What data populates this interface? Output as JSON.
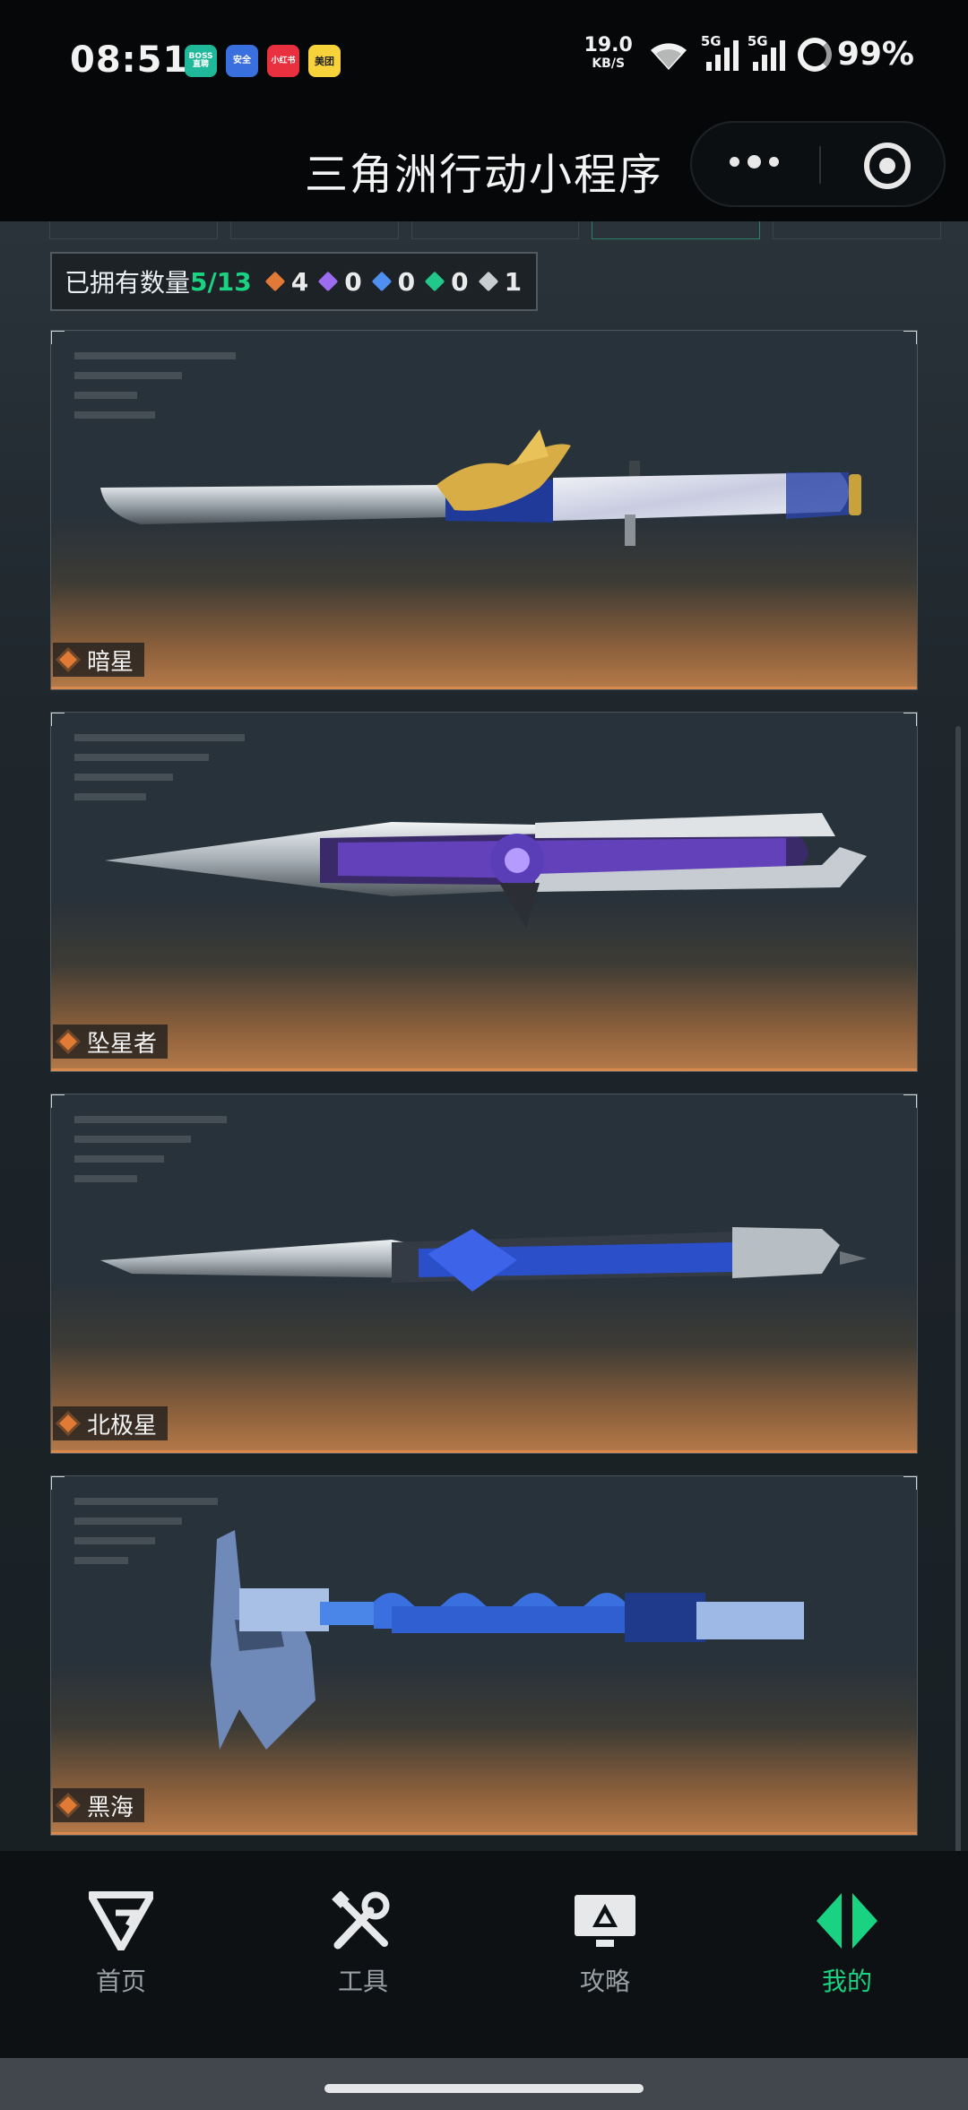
{
  "status_bar": {
    "time": "08:51",
    "app_badges": [
      {
        "label": "BOSS直聘",
        "color": "#1fb89a"
      },
      {
        "label": "安全",
        "color": "#3a6fe0"
      },
      {
        "label": "小红书",
        "color": "#e8303f"
      },
      {
        "label": "美团",
        "color": "#f7d23a"
      }
    ],
    "net_speed": "19.0",
    "net_unit": "KB/S",
    "signal_label": "5G",
    "battery": "99%"
  },
  "title_bar": {
    "title": "三角洲行动小程序"
  },
  "collection": {
    "owned_label": "已拥有数量",
    "owned_count": "5/13",
    "rarity_counts": [
      {
        "name": "orange-rarity",
        "color": "#e07a34",
        "count": "4"
      },
      {
        "name": "purple-rarity",
        "color": "#9b6cf0",
        "count": "0"
      },
      {
        "name": "blue-rarity",
        "color": "#4e8ff0",
        "count": "0"
      },
      {
        "name": "green-rarity",
        "color": "#22c88a",
        "count": "0"
      },
      {
        "name": "white-rarity",
        "color": "#c8cdd1",
        "count": "1"
      }
    ]
  },
  "items": [
    {
      "name": "暗星",
      "rarity_color": "#e07a34"
    },
    {
      "name": "坠星者",
      "rarity_color": "#e07a34"
    },
    {
      "name": "北极星",
      "rarity_color": "#e07a34"
    },
    {
      "name": "黑海",
      "rarity_color": "#e07a34"
    }
  ],
  "tabs": [
    {
      "label": "首页",
      "icon": "home-logo-icon",
      "active": false
    },
    {
      "label": "工具",
      "icon": "tools-icon",
      "active": false
    },
    {
      "label": "攻略",
      "icon": "guide-monitor-icon",
      "active": false
    },
    {
      "label": "我的",
      "icon": "profile-logo-icon",
      "active": true
    }
  ],
  "colors": {
    "accent": "#19d382",
    "rarity_orange": "#e07a34"
  }
}
